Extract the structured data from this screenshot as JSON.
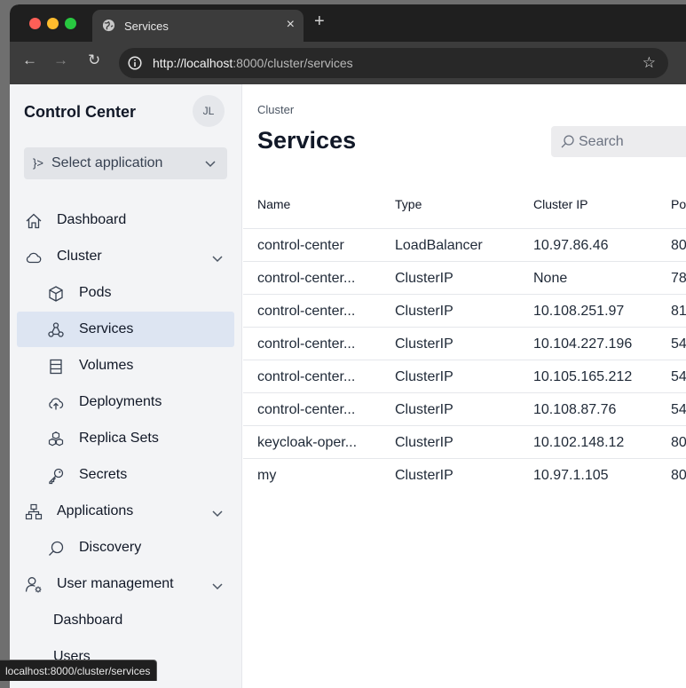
{
  "browser": {
    "tab_title": "Services",
    "tab_close": "×",
    "new_tab": "+",
    "url_host": "http://localhost",
    "url_path": ":8000/cluster/services",
    "status_url": "localhost:8000/cluster/services"
  },
  "sidebar": {
    "brand": "Control Center",
    "avatar_initials": "JL",
    "app_select": {
      "prefix": "}>",
      "label": "Select application"
    },
    "items": [
      {
        "label": "Dashboard",
        "icon": "home-icon",
        "level": 0
      },
      {
        "label": "Cluster",
        "icon": "cloud-icon",
        "level": 0,
        "expandable": true
      },
      {
        "label": "Pods",
        "icon": "cube-icon",
        "level": 1
      },
      {
        "label": "Services",
        "icon": "services-icon",
        "level": 1,
        "active": true
      },
      {
        "label": "Volumes",
        "icon": "volumes-icon",
        "level": 1
      },
      {
        "label": "Deployments",
        "icon": "cloud-upload-icon",
        "level": 1
      },
      {
        "label": "Replica Sets",
        "icon": "boxes-icon",
        "level": 1
      },
      {
        "label": "Secrets",
        "icon": "key-icon",
        "level": 1
      },
      {
        "label": "Applications",
        "icon": "sitemap-icon",
        "level": 0,
        "expandable": true
      },
      {
        "label": "Discovery",
        "icon": "search-icon",
        "level": 1
      },
      {
        "label": "User management",
        "icon": "user-gear-icon",
        "level": 0,
        "expandable": true
      },
      {
        "label": "Dashboard",
        "level": 2
      },
      {
        "label": "Users",
        "level": 2
      }
    ]
  },
  "main": {
    "breadcrumb": "Cluster",
    "title": "Services",
    "search_placeholder": "Search",
    "columns": [
      "Name",
      "Type",
      "Cluster IP",
      "Po"
    ],
    "rows": [
      [
        "control-center",
        "LoadBalancer",
        "10.97.86.46",
        "80"
      ],
      [
        "control-center...",
        "ClusterIP",
        "None",
        "78"
      ],
      [
        "control-center...",
        "ClusterIP",
        "10.108.251.97",
        "81"
      ],
      [
        "control-center...",
        "ClusterIP",
        "10.104.227.196",
        "54"
      ],
      [
        "control-center...",
        "ClusterIP",
        "10.105.165.212",
        "54"
      ],
      [
        "control-center...",
        "ClusterIP",
        "10.108.87.76",
        "54"
      ],
      [
        "keycloak-oper...",
        "ClusterIP",
        "10.102.148.12",
        "80"
      ],
      [
        "my",
        "ClusterIP",
        "10.97.1.105",
        "80"
      ]
    ]
  },
  "colors": {
    "active_bg": "#dde5f2",
    "sidebar_bg": "#f3f4f6",
    "accent_text": "#111827"
  }
}
